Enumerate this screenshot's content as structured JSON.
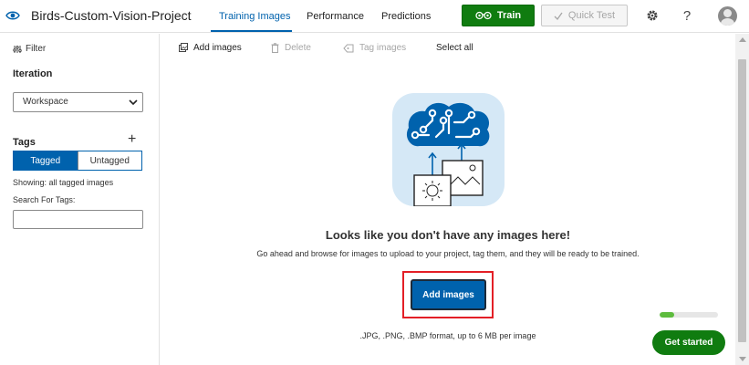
{
  "header": {
    "project_title": "Birds-Custom-Vision-Project",
    "tabs": [
      {
        "label": "Training Images",
        "active": true
      },
      {
        "label": "Performance",
        "active": false
      },
      {
        "label": "Predictions",
        "active": false
      }
    ],
    "train_label": "Train",
    "quick_test_label": "Quick Test",
    "help_label": "?"
  },
  "sidebar": {
    "filter_label": "Filter",
    "iteration_label": "Iteration",
    "iteration_value": "Workspace",
    "tags_label": "Tags",
    "add_tag_glyph": "+",
    "tag_toggle": {
      "tagged": "Tagged",
      "untagged": "Untagged",
      "selected": "Tagged"
    },
    "showing_text": "Showing: all tagged images",
    "search_label": "Search For Tags:",
    "search_value": ""
  },
  "toolbar": {
    "add_images": "Add images",
    "delete": "Delete",
    "tag_images": "Tag images",
    "select_all": "Select all"
  },
  "empty_state": {
    "heading": "Looks like you don't have any images here!",
    "subtext": "Go ahead and browse for images to upload to your project, tag them, and they will be ready to be trained.",
    "button_label": "Add images",
    "format_hint": ".JPG, .PNG, .BMP format, up to 6 MB per image"
  },
  "onboarding": {
    "progress": 0.25,
    "get_started_label": "Get started"
  },
  "colors": {
    "accent_blue": "#0062ad",
    "train_green": "#107c10",
    "highlight_red": "#e31f26",
    "progress_green": "#5ebc3e"
  },
  "icons": [
    "eye-icon",
    "glasses-icon",
    "checkmark-icon",
    "gear-icon",
    "help-icon",
    "filter-icon",
    "chevron-down-icon",
    "plus-icon",
    "image-add-icon",
    "trash-icon",
    "tag-icon",
    "brain-circuit-icon"
  ]
}
